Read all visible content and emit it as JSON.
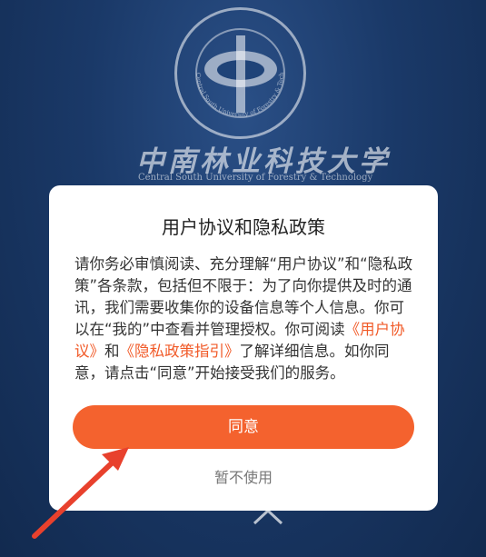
{
  "background": {
    "calligraphy": "中南林业科技大学",
    "university_name_en": "Central South University of Forestry & Technology",
    "emblem_ring_text": "Central South University of Forestry & Technology"
  },
  "dialog": {
    "title": "用户协议和隐私政策",
    "body_part1": "请你务必审慎阅读、充分理解“用户协议”和“隐私政策”各条款，包括但不限于：为了向你提供及时的通讯，我们需要收集你的设备信息等个人信息。你可以在“我的”中查看并管理授权。你可阅读",
    "link_user_agreement": "《用户协议》",
    "body_and": "和",
    "link_privacy_policy": "《隐私政策指引》",
    "body_part2": "了解详细信息。如你同意，请点击“同意”开始接受我们的服务。",
    "agree_label": "同意",
    "decline_label": "暂不使用"
  },
  "colors": {
    "accent": "#f4622e",
    "link": "#f15a28",
    "annotation_arrow": "#e8412d",
    "background": "#1a3968"
  }
}
